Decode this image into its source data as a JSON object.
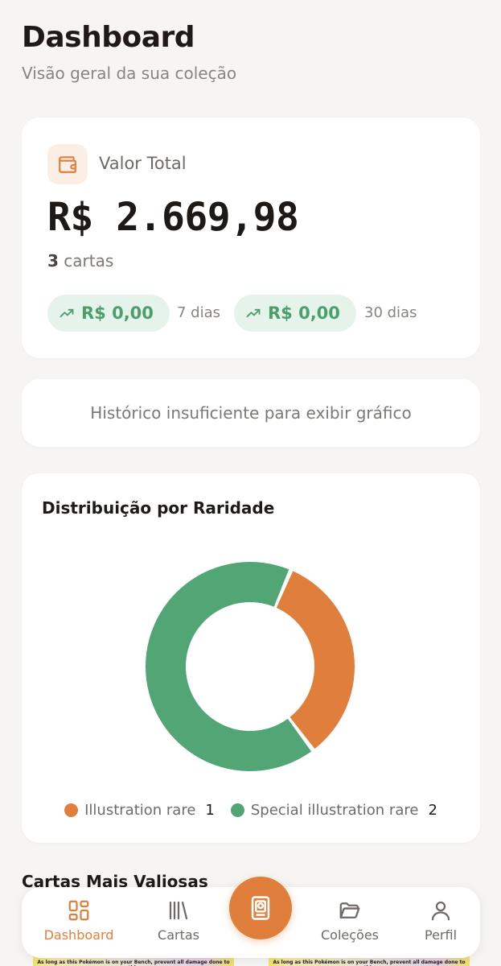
{
  "header": {
    "title": "Dashboard",
    "subtitle": "Visão geral da sua coleção"
  },
  "total_card": {
    "icon": "wallet-icon",
    "label": "Valor Total",
    "value": "R$ 2.669,98",
    "cards_count": "3",
    "cards_label": " cartas",
    "changes": [
      {
        "icon": "trending-up-icon",
        "value": "R$ 0,00",
        "period": "7 dias"
      },
      {
        "icon": "trending-up-icon",
        "value": "R$ 0,00",
        "period": "30 dias"
      }
    ]
  },
  "history": {
    "message": "Histórico insuficiente para exibir gráfico"
  },
  "rarity": {
    "title": "Distribuição por Raridade"
  },
  "chart_data": {
    "type": "pie",
    "title": "Distribuição por Raridade",
    "categories": [
      "Illustration rare",
      "Special illustration rare"
    ],
    "values": [
      1,
      2
    ],
    "colors": [
      "#e07f3c",
      "#52a574"
    ],
    "legend_placement": "bottom"
  },
  "top_cards": {
    "title": "Cartas Mais Valiosas",
    "snippet": "As long as this Pokémon is on your Bench, prevent all damage done to this"
  },
  "nav": {
    "items": [
      {
        "label": "Dashboard",
        "icon": "grid-icon",
        "active": true
      },
      {
        "label": "Cartas",
        "icon": "library-icon",
        "active": false
      },
      {
        "label": "Coleções",
        "icon": "folder-icon",
        "active": false
      },
      {
        "label": "Perfil",
        "icon": "user-icon",
        "active": false
      }
    ],
    "center_button_icon": "card-scan-icon"
  },
  "colors": {
    "accent": "#e07f3c",
    "positive": "#4d9e6e",
    "positive_bg": "#e6f3ea"
  }
}
